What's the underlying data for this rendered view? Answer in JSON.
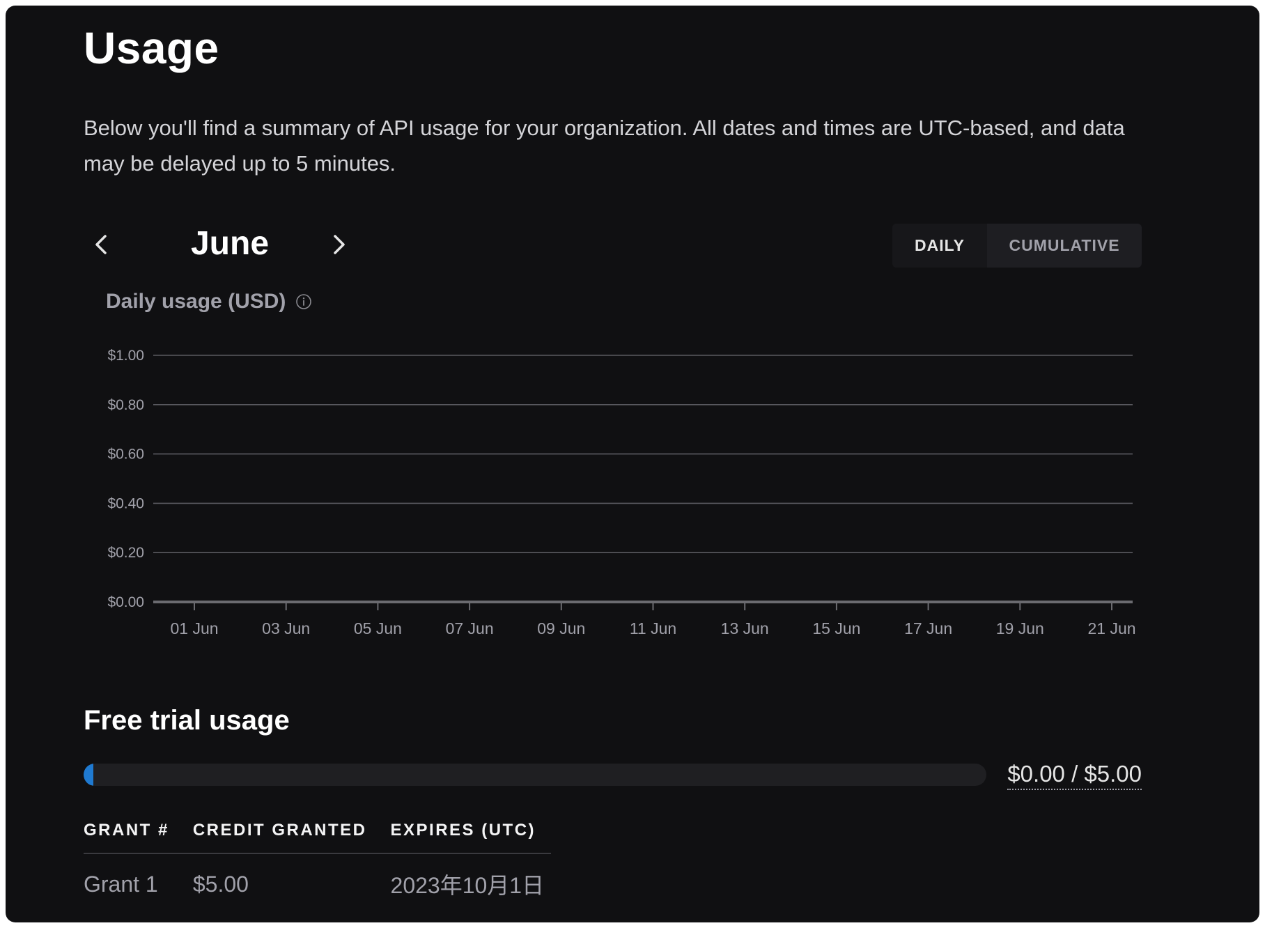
{
  "page": {
    "title": "Usage",
    "description": "Below you'll find a summary of API usage for your organization. All dates and times are UTC-based, and data may be delayed up to 5 minutes."
  },
  "month_nav": {
    "month": "June",
    "prev_icon": "chevron-left-icon",
    "next_icon": "chevron-right-icon"
  },
  "view_toggle": {
    "daily_label": "DAILY",
    "cumulative_label": "CUMULATIVE",
    "selected": "DAILY"
  },
  "chart_data": {
    "type": "bar",
    "title": "Daily usage (USD)",
    "title_icon": "info-icon",
    "xlabel": "",
    "ylabel": "",
    "ylim": [
      0,
      1.0
    ],
    "y_ticks": [
      "$0.00",
      "$0.20",
      "$0.40",
      "$0.60",
      "$0.80",
      "$1.00"
    ],
    "y_tick_values": [
      0,
      0.2,
      0.4,
      0.6,
      0.8,
      1.0
    ],
    "categories": [
      "01 Jun",
      "03 Jun",
      "05 Jun",
      "07 Jun",
      "09 Jun",
      "11 Jun",
      "13 Jun",
      "15 Jun",
      "17 Jun",
      "19 Jun",
      "21 Jun"
    ],
    "values": [
      0,
      0,
      0,
      0,
      0,
      0,
      0,
      0,
      0,
      0,
      0
    ],
    "grid": true
  },
  "free_trial": {
    "title": "Free trial usage",
    "used_fraction": 0.0,
    "amount_text": "$0.00 / $5.00",
    "bar_color": "#1f7ad1"
  },
  "grants": {
    "headers": [
      "GRANT #",
      "CREDIT GRANTED",
      "EXPIRES (UTC)"
    ],
    "rows": [
      [
        "Grant 1",
        "$5.00",
        "2023年10月1日"
      ]
    ]
  },
  "colors": {
    "background": "#101012",
    "gridline": "#5a5a60",
    "axis": "#6b6b70",
    "tick_text": "#a1a1aa"
  }
}
